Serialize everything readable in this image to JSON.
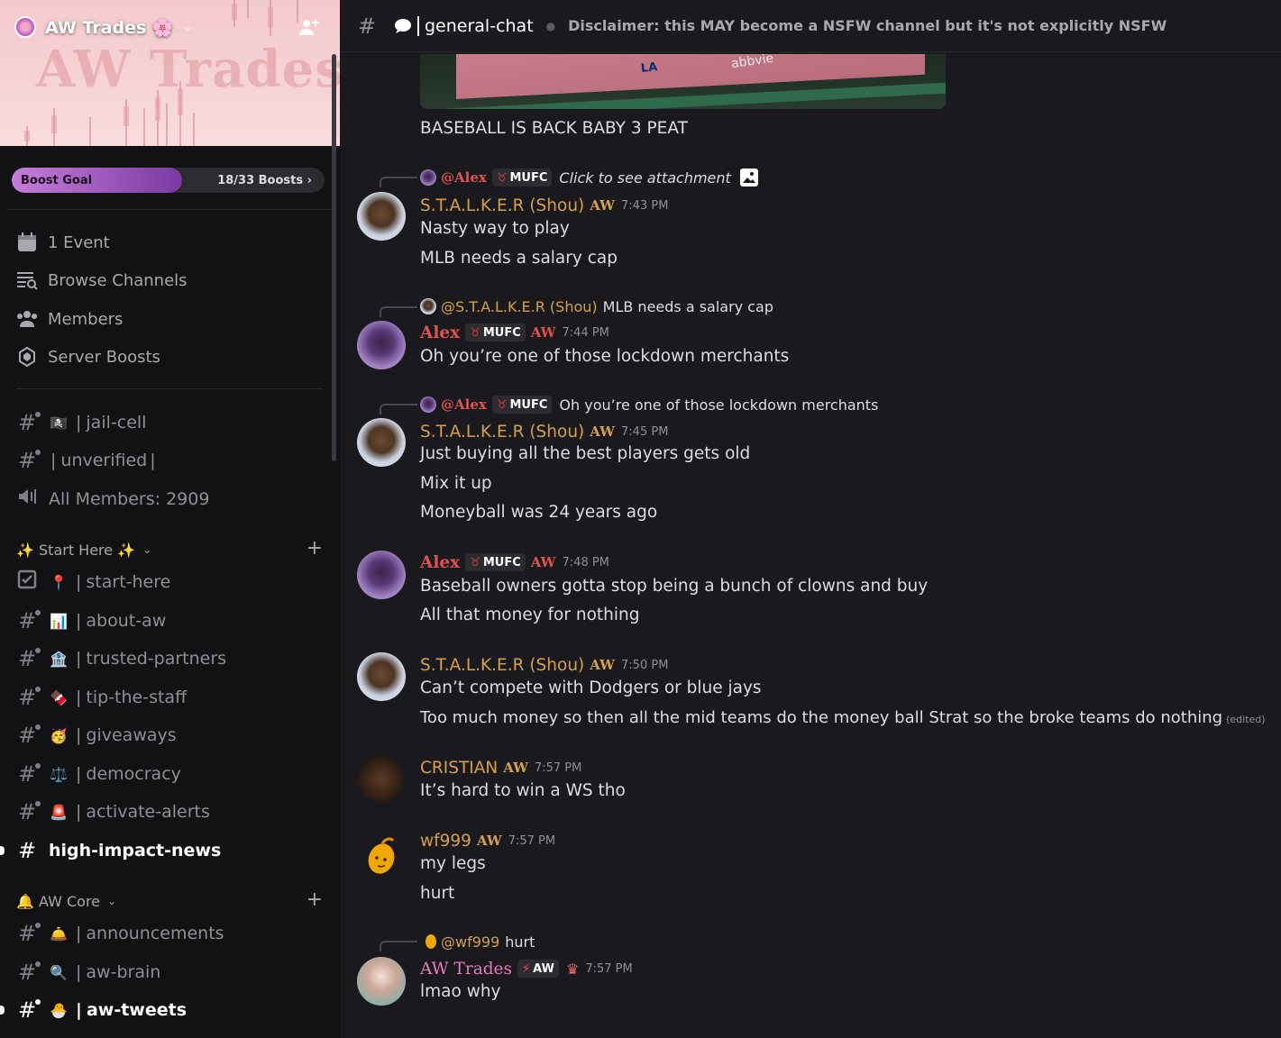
{
  "server": {
    "name": "AW Trades 🌸",
    "banner_watermark": "AW Trades"
  },
  "boost": {
    "label": "Boost Goal",
    "count": "18/33 Boosts",
    "progress": 0.545
  },
  "nav": {
    "events": "1 Event",
    "browse": "Browse Channels",
    "members": "Members",
    "boosts": "Server Boosts"
  },
  "top_channels": [
    {
      "emoji": "🏴‍☠️",
      "name": "jail-cell"
    },
    {
      "emoji": "",
      "name": "unverified"
    },
    {
      "emoji": "",
      "name": "All Members: 2909"
    }
  ],
  "categories": {
    "start_here": "✨ Start Here ✨",
    "aw_core": "🔔 AW Core"
  },
  "start_channels": [
    {
      "emoji": "📍",
      "name": "start-here"
    },
    {
      "emoji": "📊",
      "name": "about-aw"
    },
    {
      "emoji": "🏦",
      "name": "trusted-partners"
    },
    {
      "emoji": "🍫",
      "name": "tip-the-staff"
    },
    {
      "emoji": "🥳",
      "name": "giveaways"
    },
    {
      "emoji": "⚖️",
      "name": "democracy"
    },
    {
      "emoji": "🚨",
      "name": "activate-alerts"
    },
    {
      "emoji": "",
      "name": "high-impact-news"
    }
  ],
  "core_channels": [
    {
      "emoji": "🛎️",
      "name": "announcements"
    },
    {
      "emoji": "🔍",
      "name": "aw-brain"
    },
    {
      "emoji": "🐣",
      "name": "aw-tweets"
    }
  ],
  "header": {
    "channel": "general-chat",
    "topic": "Disclaimer: this MAY become a NSFW channel but it's not explicitly NSFW"
  },
  "attachment": {
    "logo_text": "LA",
    "sponsor_text": "abbvie"
  },
  "messages": {
    "m0_text": "BASEBALL IS BACK BABY 3 PEAT",
    "m1_reply_name": "@Alex",
    "m1_reply_tag": "MUFC",
    "m1_reply_text": "Click to see attachment",
    "m1_author": "S.T.A.L.K.E.R (Shou)",
    "m1_tag": "AW",
    "m1_time": "7:43 PM",
    "m1_lines": [
      "Nasty way to play",
      "MLB needs a salary cap"
    ],
    "m2_reply_name": "@S.T.A.L.K.E.R (Shou)",
    "m2_reply_text": "MLB needs a salary cap",
    "m2_author": "Alex",
    "m2_badge": "MUFC",
    "m2_tag": "AW",
    "m2_time": "7:44 PM",
    "m2_lines": [
      "Oh you’re one of those lockdown merchants"
    ],
    "m3_reply_name": "@Alex",
    "m3_reply_tag": "MUFC",
    "m3_reply_text": "Oh you’re one of those lockdown merchants",
    "m3_author": "S.T.A.L.K.E.R (Shou)",
    "m3_tag": "AW",
    "m3_time": "7:45 PM",
    "m3_lines": [
      "Just buying all the best players gets old",
      "Mix it up",
      "Moneyball was 24 years ago"
    ],
    "m4_author": "Alex",
    "m4_badge": "MUFC",
    "m4_tag": "AW",
    "m4_time": "7:48 PM",
    "m4_lines": [
      "Baseball owners gotta stop being a bunch of clowns and buy",
      "All that money for nothing"
    ],
    "m5_author": "S.T.A.L.K.E.R (Shou)",
    "m5_tag": "AW",
    "m5_time": "7:50 PM",
    "m5_lines": [
      "Can’t compete with Dodgers or blue jays",
      "Too much money so then all the mid teams do the money ball Strat so the broke teams do nothing"
    ],
    "m5_edited": "(edited)",
    "m6_author": "CRISTIAN",
    "m6_tag": "AW",
    "m6_time": "7:57 PM",
    "m6_lines": [
      "It’s hard to win a WS tho"
    ],
    "m7_author": "wf999",
    "m7_tag": "AW",
    "m7_time": "7:57 PM",
    "m7_lines": [
      "my legs",
      "hurt"
    ],
    "m8_reply_name": "@wf999",
    "m8_reply_text": "hurt",
    "m8_author": "AW Trades",
    "m8_badge": "AW",
    "m8_time": "7:57 PM",
    "m8_lines": [
      "lmao why"
    ]
  },
  "colors": {
    "accent_gold": "#d4a04b",
    "alex_red": "#e05252",
    "aw_pink": "#e87ac0",
    "boost_purple": "#7a3aa3"
  }
}
